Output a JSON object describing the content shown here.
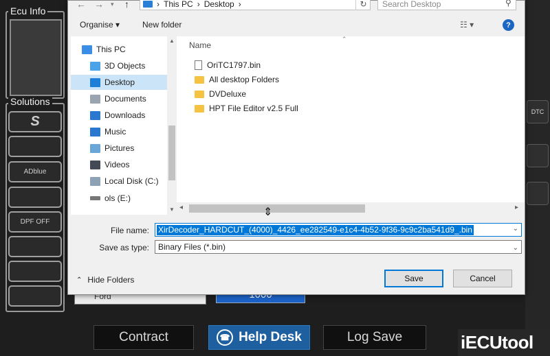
{
  "app": {
    "ecu_info_label": "Ecu Info",
    "solutions_label": "Solutions",
    "solution_buttons": [
      "S",
      "",
      "ADblue",
      "",
      "DPF OFF",
      "",
      "",
      ""
    ],
    "right_icons": [
      "DTC",
      "",
      ""
    ],
    "bottom_buttons": {
      "contract": "Contract",
      "help_desk": "Help Desk",
      "log_save": "Log Save"
    },
    "behind_field_text": "Ford",
    "behind_blue_value": "1000",
    "watermark": "iECUtool"
  },
  "dialog": {
    "breadcrumb": [
      "This PC",
      "Desktop"
    ],
    "search_placeholder": "Search Desktop",
    "toolbar": {
      "organise": "Organise ▾",
      "new_folder": "New folder",
      "help": "?"
    },
    "nav_items": [
      {
        "label": "This PC",
        "icon": "pc-icon",
        "color": "#3a8ee6"
      },
      {
        "label": "3D Objects",
        "icon": "cube-icon",
        "color": "#4aa3e8"
      },
      {
        "label": "Desktop",
        "icon": "desktop-icon",
        "color": "#1e7fd8"
      },
      {
        "label": "Documents",
        "icon": "document-icon",
        "color": "#9aa5b1"
      },
      {
        "label": "Downloads",
        "icon": "download-icon",
        "color": "#2a78d0"
      },
      {
        "label": "Music",
        "icon": "music-icon",
        "color": "#2a78d0"
      },
      {
        "label": "Pictures",
        "icon": "picture-icon",
        "color": "#6aa6d8"
      },
      {
        "label": "Videos",
        "icon": "video-icon",
        "color": "#444a55"
      },
      {
        "label": "Local Disk (C:)",
        "icon": "disk-icon",
        "color": "#8ea2b5"
      },
      {
        "label": "ols (E:)",
        "icon": "usb-drive-icon",
        "color": "#777777"
      }
    ],
    "selected_nav": "Desktop",
    "column_header": "Name",
    "files": [
      {
        "name": "OriTC1797.bin",
        "type": "file"
      },
      {
        "name": "All desktop Folders",
        "type": "folder"
      },
      {
        "name": "DVDeluxe",
        "type": "folder"
      },
      {
        "name": "HPT File Editor v2.5 Full",
        "type": "folder"
      }
    ],
    "file_name_label": "File name:",
    "file_name_value": "XirDecoder_HARDCUT_(4000)_4426_ee282549-e1c4-4b52-9f36-9c9c2ba541d9_.bin",
    "save_type_label": "Save as type:",
    "save_type_value": "Binary Files (*.bin)",
    "hide_folders": "Hide Folders",
    "save_button": "Save",
    "cancel_button": "Cancel"
  },
  "colors": {
    "accent": "#0078d7",
    "help_desk": "#1d5f9f",
    "folder": "#f5c242"
  }
}
